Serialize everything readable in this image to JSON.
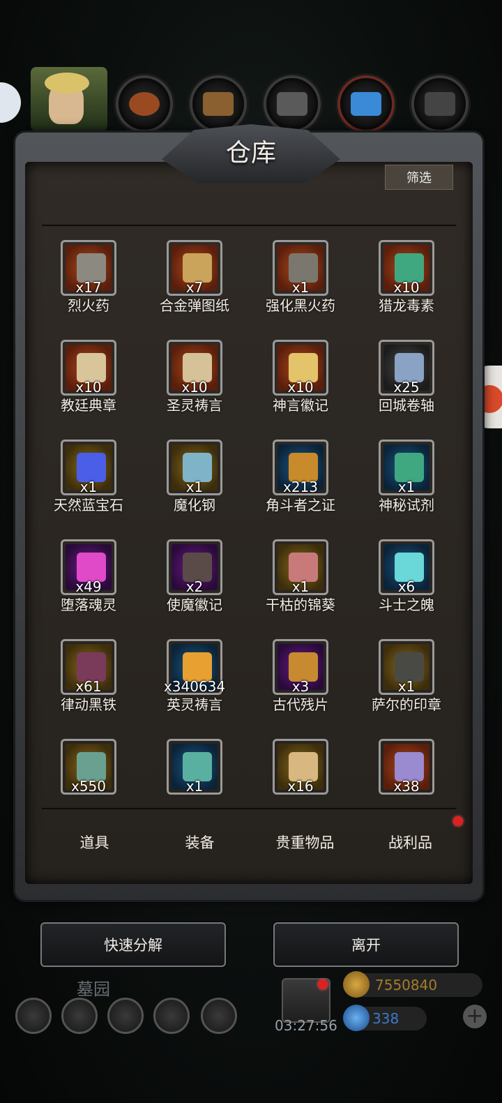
{
  "window": {
    "title": "仓库"
  },
  "toolbar": {
    "filter_label": "筛选"
  },
  "items": [
    {
      "name": "烈火药",
      "count": "x17",
      "rarity": "orange",
      "color": "#8c8a80"
    },
    {
      "name": "合金弹图纸",
      "count": "x7",
      "rarity": "orange",
      "color": "#c9a45a"
    },
    {
      "name": "强化黑火药",
      "count": "x1",
      "rarity": "orange",
      "color": "#7a786e"
    },
    {
      "name": "猎龙毒素",
      "count": "x10",
      "rarity": "orange",
      "color": "#3fa880"
    },
    {
      "name": "教廷典章",
      "count": "x10",
      "rarity": "orange",
      "color": "#d8c59a"
    },
    {
      "name": "圣灵祷言",
      "count": "x10",
      "rarity": "orange",
      "color": "#d6c298"
    },
    {
      "name": "神言徽记",
      "count": "x10",
      "rarity": "orange",
      "color": "#e3c46a"
    },
    {
      "name": "回城卷轴",
      "count": "x25",
      "rarity": "gray",
      "color": "#8aa3c4"
    },
    {
      "name": "天然蓝宝石",
      "count": "x1",
      "rarity": "gold",
      "color": "#4a5ee8"
    },
    {
      "name": "魔化钢",
      "count": "x1",
      "rarity": "gold",
      "color": "#7fb4c8"
    },
    {
      "name": "角斗者之证",
      "count": "x213",
      "rarity": "blue",
      "color": "#c88a2a"
    },
    {
      "name": "神秘试剂",
      "count": "x1",
      "rarity": "blue",
      "color": "#3fa880"
    },
    {
      "name": "堕落魂灵",
      "count": "x49",
      "rarity": "purple",
      "color": "#e04ac8"
    },
    {
      "name": "使魔徽记",
      "count": "x2",
      "rarity": "purple",
      "color": "#5a4a48"
    },
    {
      "name": "干枯的锦葵",
      "count": "x1",
      "rarity": "gold",
      "color": "#c87a7a"
    },
    {
      "name": "斗士之魄",
      "count": "x6",
      "rarity": "blue",
      "color": "#6ad8d8"
    },
    {
      "name": "律动黑铁",
      "count": "x61",
      "rarity": "gold",
      "color": "#7a3a5a"
    },
    {
      "name": "英灵祷言",
      "count": "x340634",
      "rarity": "blue",
      "color": "#e8a030"
    },
    {
      "name": "古代残片",
      "count": "x3",
      "rarity": "purple",
      "color": "#c88a30"
    },
    {
      "name": "萨尔的印章",
      "count": "x1",
      "rarity": "gold",
      "color": "#4a4a44"
    },
    {
      "name": "",
      "count": "x550",
      "rarity": "gold",
      "color": "#6aa090"
    },
    {
      "name": "",
      "count": "x1",
      "rarity": "blue",
      "color": "#5ab0a0"
    },
    {
      "name": "",
      "count": "x16",
      "rarity": "gold",
      "color": "#d8b880"
    },
    {
      "name": "",
      "count": "x38",
      "rarity": "orange",
      "color": "#9a8ad0"
    }
  ],
  "tabs": [
    {
      "label": "道具"
    },
    {
      "label": "装备"
    },
    {
      "label": "贵重物品"
    },
    {
      "label": "战利品"
    }
  ],
  "actions": {
    "quick_decompose": "快速分解",
    "leave": "离开"
  },
  "hud": {
    "location": "墓园",
    "timer": "03:27:56",
    "gold": "7550840",
    "gems": "338"
  },
  "icons": [
    "chat-icon",
    "hero-avatar",
    "potion-category-icon",
    "scroll-category-icon",
    "armor-category-icon",
    "crystal-category-icon",
    "dark-armor-category-icon",
    "gift-box-icon",
    "gold-coin-icon",
    "gem-icon",
    "plus-icon"
  ],
  "colors": {
    "red_dot": "#e02020",
    "gold_text": "#a67c2a",
    "gem_text": "#3a7acc"
  }
}
